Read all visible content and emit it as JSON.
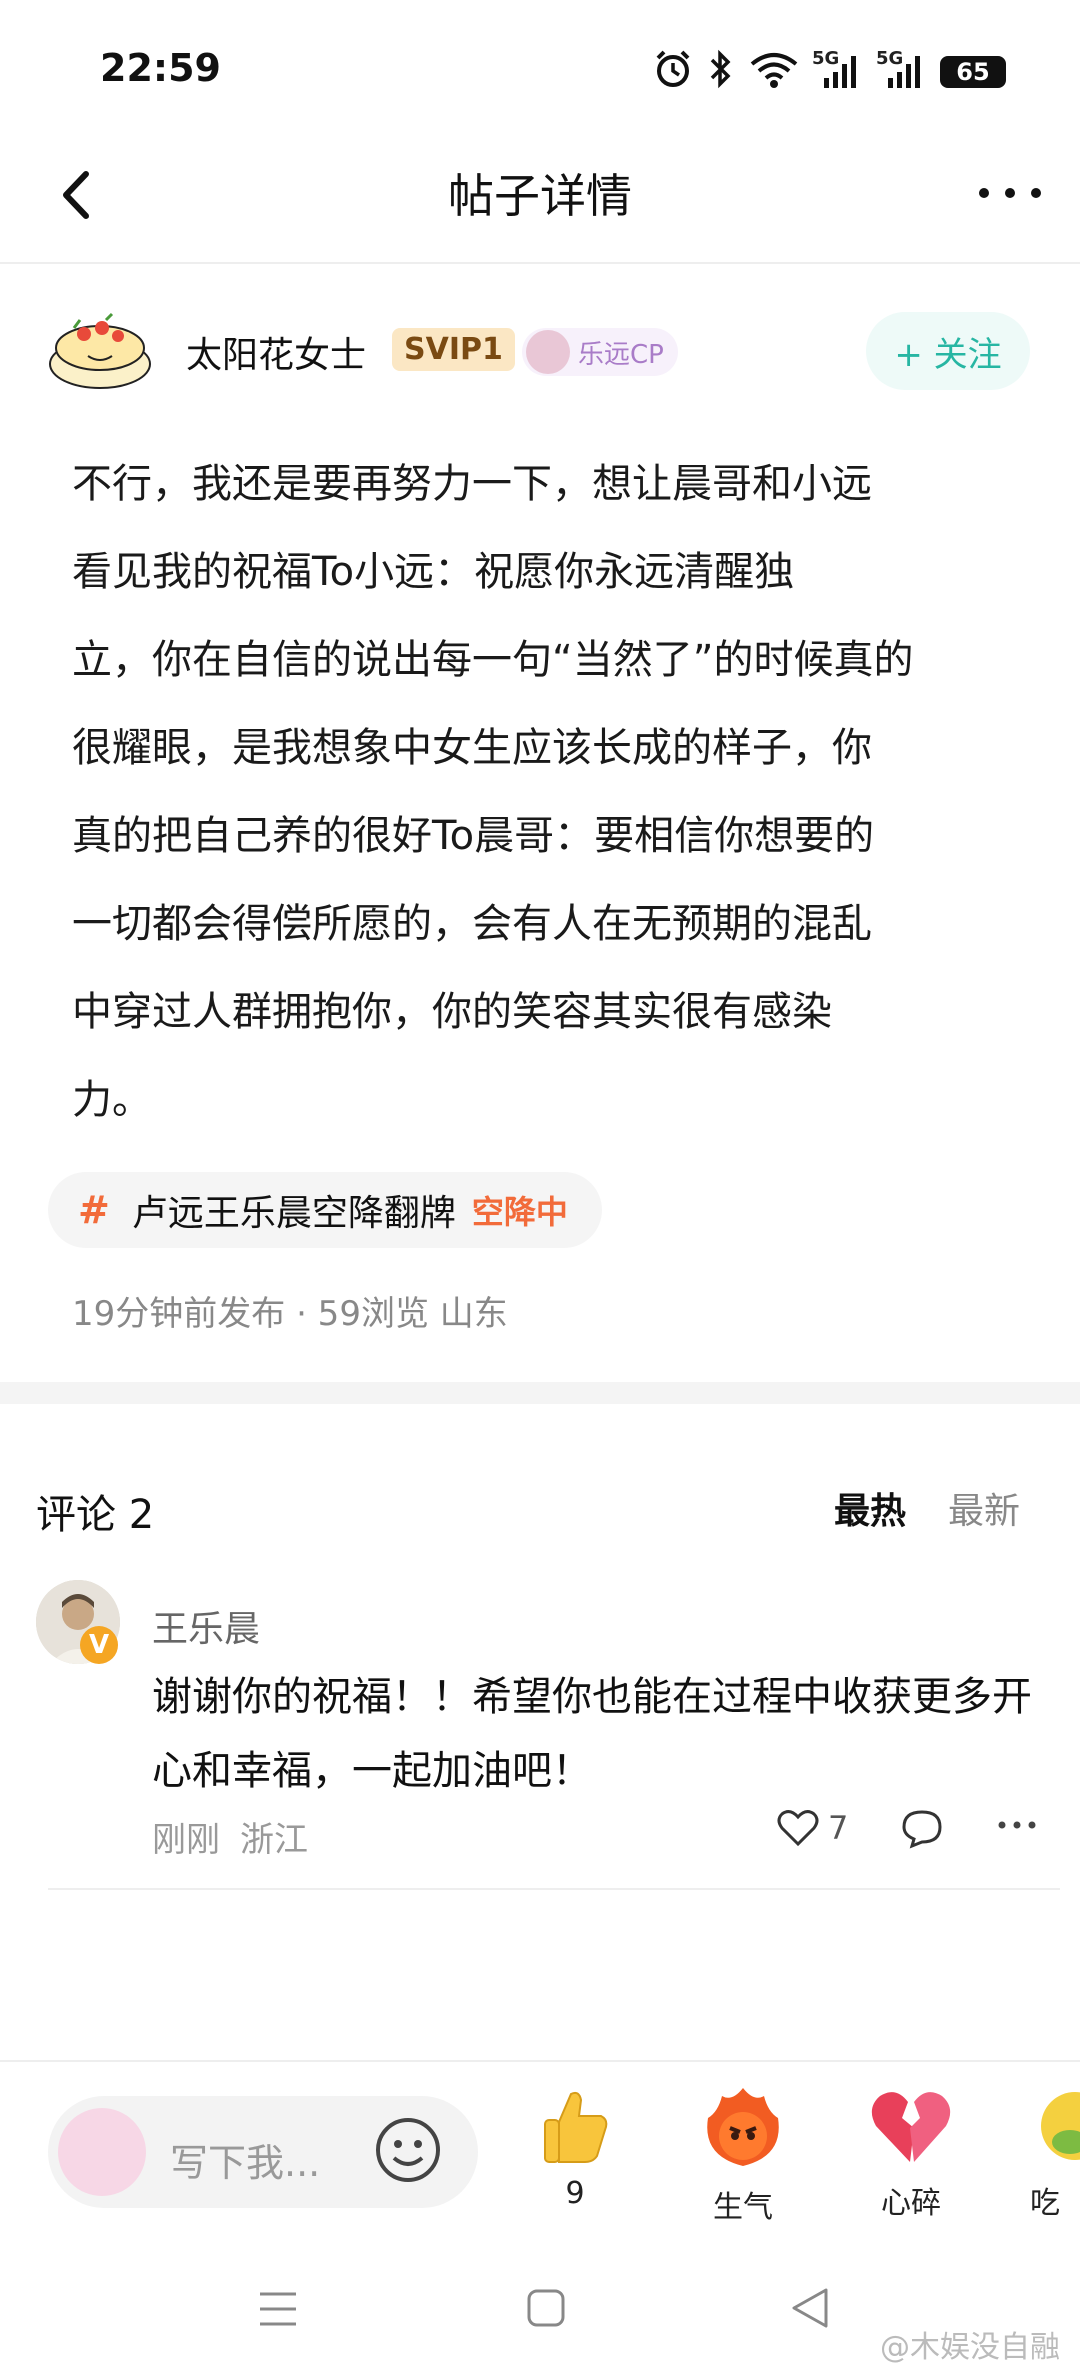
{
  "status_bar": {
    "time": "22:59",
    "network1": "5G",
    "network2": "5G",
    "battery": "65"
  },
  "header": {
    "title": "帖子详情",
    "back_icon": "chevron-left-icon",
    "more_icon": "more-horizontal-icon"
  },
  "author": {
    "name": "太阳花女士",
    "vip_badge": "SVIP1",
    "cp_badge": "乐远CP",
    "follow_label": "+ 关注"
  },
  "post": {
    "body": "不行，我还是要再努力一下，想让晨哥和小远\n看见￼￼我的祝福To小远：祝愿你永远清醒独\n立，你在自信的说出每一句“当然了”的时候真的\n很耀眼，是我想象中女生应该长成的样子，你\n真的把自己养的很好To晨哥：要相信你想要的\n一切都会得偿所愿的，会有人在无预期的混乱\n中穿过人群拥抱你，你的笑容其实很有感染\n力。",
    "topic": {
      "hash": "#",
      "name": "卢远王乐晨空降翻牌",
      "status": "空降中"
    },
    "meta": "19分钟前发布 · 59浏览  山东"
  },
  "comments": {
    "title": "评论 2",
    "sort_hot": "最热",
    "sort_new": "最新",
    "items": [
      {
        "name": "王乐晨",
        "verified": "V",
        "text": "谢谢你的祝福！！希望你也能在过程中收获更多开心和幸福，一起加油吧！",
        "time": "刚刚",
        "region": "浙江",
        "likes": "7"
      }
    ]
  },
  "bottom_bar": {
    "placeholder": "写下我...",
    "reactions": [
      {
        "label": "9",
        "icon": "thumbs-up-icon"
      },
      {
        "label": "生气",
        "icon": "angry-fire-icon"
      },
      {
        "label": "心碎",
        "icon": "broken-heart-icon"
      },
      {
        "label": "吃",
        "icon": "eating-icon"
      }
    ]
  },
  "watermark": "@木娱没自融",
  "colors": {
    "accent_teal": "#27b6a3",
    "topic_orange": "#f26b3a",
    "vip_gold": "#fbe7c4"
  }
}
